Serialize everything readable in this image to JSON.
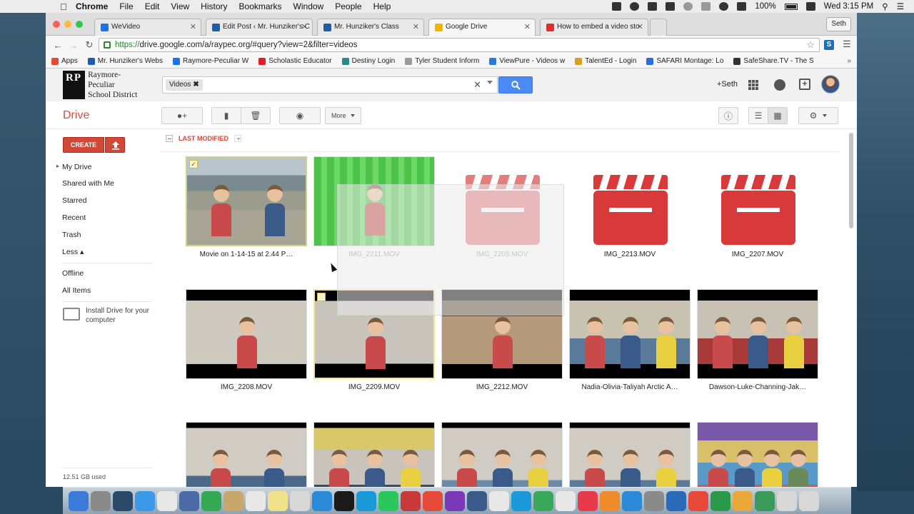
{
  "menubar": {
    "app": "Chrome",
    "items": [
      "File",
      "Edit",
      "View",
      "History",
      "Bookmarks",
      "Window",
      "People",
      "Help"
    ],
    "battery": "100%",
    "clock": "Wed 3:15 PM"
  },
  "tabs": [
    {
      "title": "WeVideo",
      "color": "#1a73e8"
    },
    {
      "title": "Edit Post ‹ Mr. Hunziker's C",
      "color": "#1a5fa8"
    },
    {
      "title": "Mr. Hunziker's Class",
      "color": "#1a5fa8"
    },
    {
      "title": "Google Drive",
      "color": "#f4b400"
    },
    {
      "title": "How to embed a video sto",
      "color": "#e52d27"
    }
  ],
  "profile_name": "Seth",
  "url": {
    "scheme": "https://",
    "rest": "drive.google.com/a/raypec.org/#query?view=2&filter=videos"
  },
  "bookmarks": [
    {
      "label": "Apps",
      "color": "#e34a33"
    },
    {
      "label": "Mr. Hunziker's Webs",
      "color": "#1a5fa8"
    },
    {
      "label": "Raymore-Peculiar W",
      "color": "#1a73e8"
    },
    {
      "label": "Scholastic Educator",
      "color": "#e31b23"
    },
    {
      "label": "Destiny Login",
      "color": "#2a8a8a"
    },
    {
      "label": "Tyler Student Inform",
      "color": "#999999"
    },
    {
      "label": "ViewPure - Videos w",
      "color": "#2a7ad8"
    },
    {
      "label": "TalentEd - Login",
      "color": "#d8a020"
    },
    {
      "label": "SAFARI Montage: Lo",
      "color": "#2a6fd8"
    },
    {
      "label": "SafeShare.TV - The S",
      "color": "#333333"
    }
  ],
  "bookmarks_more": "»",
  "school": {
    "initials": "RP",
    "line1": "Raymore-Peculiar",
    "line2": "School District"
  },
  "search": {
    "chip": "Videos"
  },
  "header_user": "+Seth",
  "drive_title": "Drive",
  "actions": {
    "more": "More"
  },
  "sidebar": {
    "create": "CREATE",
    "items": [
      "My Drive",
      "Shared with Me",
      "Starred",
      "Recent",
      "Trash",
      "Less ▴"
    ],
    "items2": [
      "Offline",
      "All Items"
    ],
    "install": "Install Drive for your computer",
    "storage": "12.51 GB used"
  },
  "sort_label": "LAST MODIFIED",
  "files": [
    {
      "name": "Movie on 1-14-15 at 2.44 P…",
      "kind": "photo",
      "scene": "mountain"
    },
    {
      "name": "IMG_2211.MOV",
      "kind": "photo",
      "scene": "greenscreen"
    },
    {
      "name": "IMG_2205.MOV",
      "kind": "clapper"
    },
    {
      "name": "IMG_2213.MOV",
      "kind": "clapper"
    },
    {
      "name": "IMG_2207.MOV",
      "kind": "clapper"
    },
    {
      "name": "IMG_2208.MOV",
      "kind": "photo",
      "scene": "girl-wall"
    },
    {
      "name": "IMG_2209.MOV",
      "kind": "photo",
      "scene": "boy-wall"
    },
    {
      "name": "IMG_2212.MOV",
      "kind": "photo",
      "scene": "boy-yellow"
    },
    {
      "name": "Nadia-Olivia-Taliyah Arctic A…",
      "kind": "photo",
      "scene": "girls-three"
    },
    {
      "name": "Dawson-Luke-Channing-Jak…",
      "kind": "photo",
      "scene": "boys-red"
    },
    {
      "name": "",
      "kind": "photo",
      "scene": "two-girls"
    },
    {
      "name": "",
      "kind": "photo",
      "scene": "boys-poster"
    },
    {
      "name": "",
      "kind": "photo",
      "scene": "kids-wall"
    },
    {
      "name": "",
      "kind": "photo",
      "scene": "kids-three"
    },
    {
      "name": "",
      "kind": "photo",
      "scene": "classroom"
    }
  ],
  "colors": {
    "accent": "#dd4b39",
    "search_blue": "#4a8af4",
    "clapper_red": "#d8393a"
  }
}
